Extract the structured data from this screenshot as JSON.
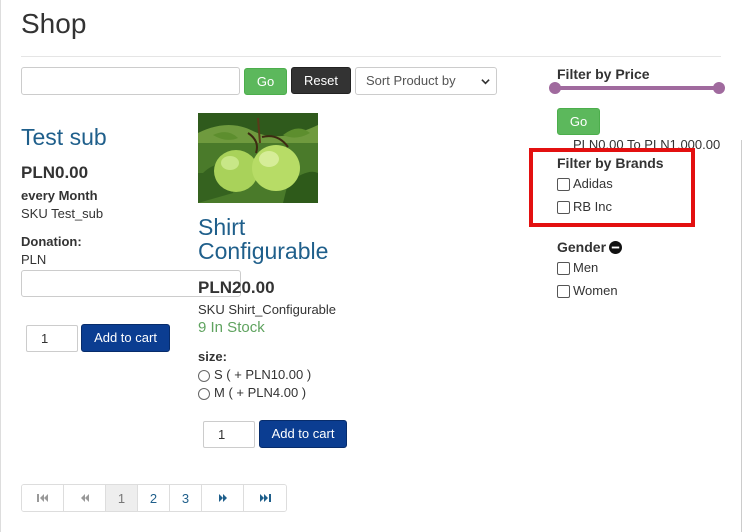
{
  "page": {
    "title": "Shop"
  },
  "toolbar": {
    "search_value": "",
    "go_label": "Go",
    "reset_label": "Reset",
    "sort_selected": "Sort Product by"
  },
  "products": [
    {
      "title": "Test sub",
      "price": "PLN0.00",
      "period": "every Month",
      "sku": "SKU Test_sub",
      "donation_label": "Donation:",
      "currency": "PLN",
      "quantity": "1",
      "add_label": "Add to cart"
    },
    {
      "title": "Shirt Configurable",
      "image_icon": "green-apple-photo",
      "price": "PLN20.00",
      "sku": "SKU Shirt_Configurable",
      "stock": "9 In Stock",
      "size_label": "size:",
      "size_options": [
        "S ( + PLN10.00 )",
        "M ( + PLN4.00 )"
      ],
      "quantity": "1",
      "add_label": "Add to cart"
    }
  ],
  "sidebar": {
    "price_filter_title": "Filter by Price",
    "price_go_label": "Go",
    "price_range": "PLN0.00 To PLN1,000.00",
    "brands_title": "Filter by Brands",
    "brands": [
      "Adidas",
      "RB Inc"
    ],
    "gender_title": "Gender",
    "genders": [
      "Men",
      "Women"
    ],
    "highlight_color": "#e31010",
    "slider_color": "#a06a9e"
  },
  "pagination": {
    "first_icon": "first-page-icon",
    "prev_icon": "prev-page-icon",
    "pages": [
      "1",
      "2",
      "3"
    ],
    "current_page": "1",
    "next_icon": "next-page-icon",
    "last_icon": "last-page-icon"
  },
  "colors": {
    "accent_blue": "#1f5f8b",
    "button_green": "#5cb85c",
    "button_dark_blue": "#0b3d91",
    "stock_green": "#5fa35f"
  }
}
